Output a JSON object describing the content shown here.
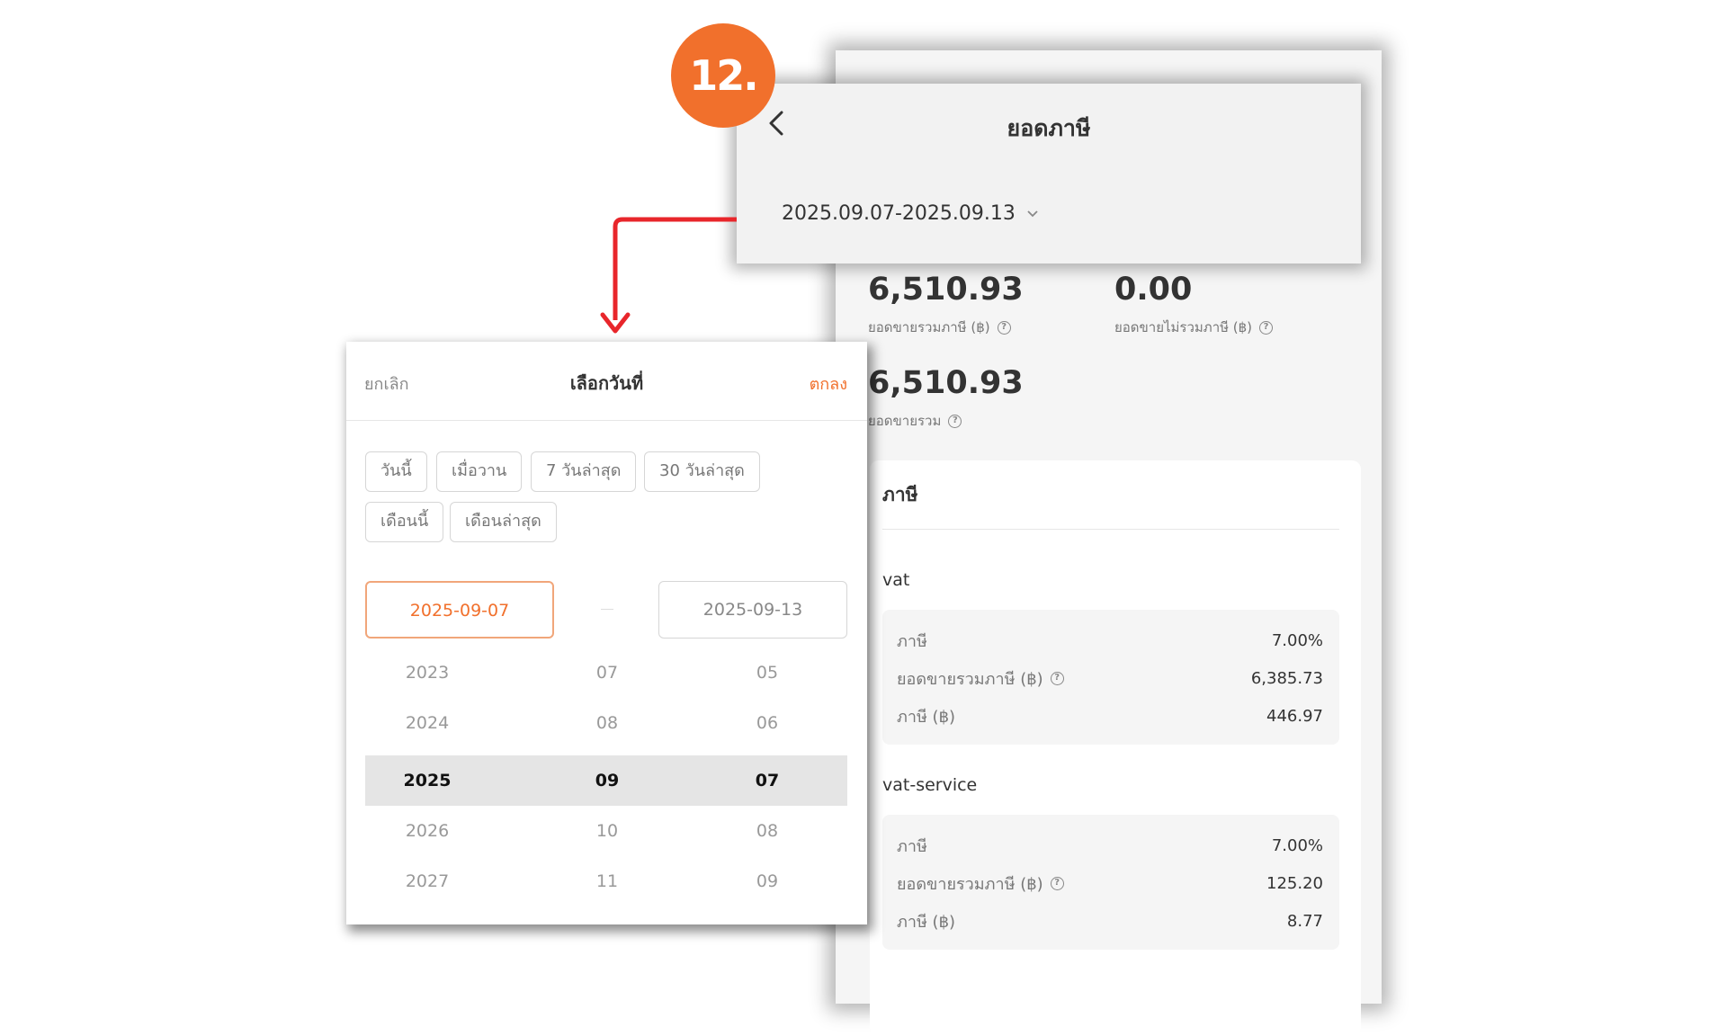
{
  "step_badge": "12.",
  "header": {
    "title": "ยอดภาษี",
    "date_range": "2025.09.07-2025.09.13"
  },
  "summary": {
    "taxed_sales_value": "6,510.93",
    "taxed_sales_label": "ยอดขายรวมภาษี (฿)",
    "untaxed_sales_value": "0.00",
    "untaxed_sales_label": "ยอดขายไม่รวมภาษี (฿)",
    "total_sales_value": "6,510.93",
    "total_sales_label": "ยอดขายรวม"
  },
  "tax_section": {
    "title": "ภาษี",
    "groups": [
      {
        "name": "vat",
        "rows": [
          {
            "label": "ภาษี",
            "value": "7.00%"
          },
          {
            "label": "ยอดขายรวมภาษี (฿)",
            "value": "6,385.73"
          },
          {
            "label": "ภาษี (฿)",
            "value": "446.97"
          }
        ]
      },
      {
        "name": "vat-service",
        "rows": [
          {
            "label": "ภาษี",
            "value": "7.00%"
          },
          {
            "label": "ยอดขายรวมภาษี (฿)",
            "value": "125.20"
          },
          {
            "label": "ภาษี (฿)",
            "value": "8.77"
          }
        ]
      }
    ]
  },
  "picker": {
    "cancel": "ยกเลิก",
    "title": "เลือกวันที่",
    "confirm": "ตกลง",
    "quick_ranges": [
      "วันนี้",
      "เมื่อวาน",
      "7 วันล่าสุด",
      "30 วันล่าสุด",
      "เดือนนี้",
      "เดือนล่าสุด"
    ],
    "start_date": "2025-09-07",
    "end_date": "2025-09-13",
    "years": [
      "2023",
      "2024",
      "2025",
      "2026",
      "2027"
    ],
    "months": [
      "07",
      "08",
      "09",
      "10",
      "11"
    ],
    "days": [
      "05",
      "06",
      "07",
      "08",
      "09"
    ],
    "selected_index": 2
  },
  "colors": {
    "accent": "#f1702c",
    "arrow": "#e8262b"
  }
}
